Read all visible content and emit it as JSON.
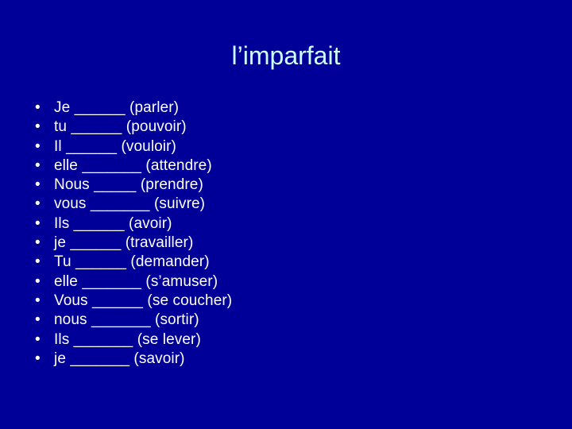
{
  "slide": {
    "title": "l’imparfait",
    "background_color": "#000099",
    "title_color": "#ccffff",
    "body_color": "#ffffff",
    "bullet_glyph": "•",
    "items": [
      {
        "text": "Je ______ (parler)"
      },
      {
        "text": "tu ______ (pouvoir)"
      },
      {
        "text": "Il ______ (vouloir)"
      },
      {
        "text": "elle _______ (attendre)"
      },
      {
        "text": "Nous _____ (prendre)"
      },
      {
        "text": "vous _______ (suivre)"
      },
      {
        "text": "Ils ______ (avoir)"
      },
      {
        "text": "je ______ (travailler)"
      },
      {
        "text": "Tu ______ (demander)"
      },
      {
        "text": "elle _______ (s’amuser)"
      },
      {
        "text": "Vous ______ (se coucher)"
      },
      {
        "text": "nous _______ (sortir)"
      },
      {
        "text": "Ils _______ (se lever)"
      },
      {
        "text": "je _______ (savoir)"
      }
    ]
  }
}
